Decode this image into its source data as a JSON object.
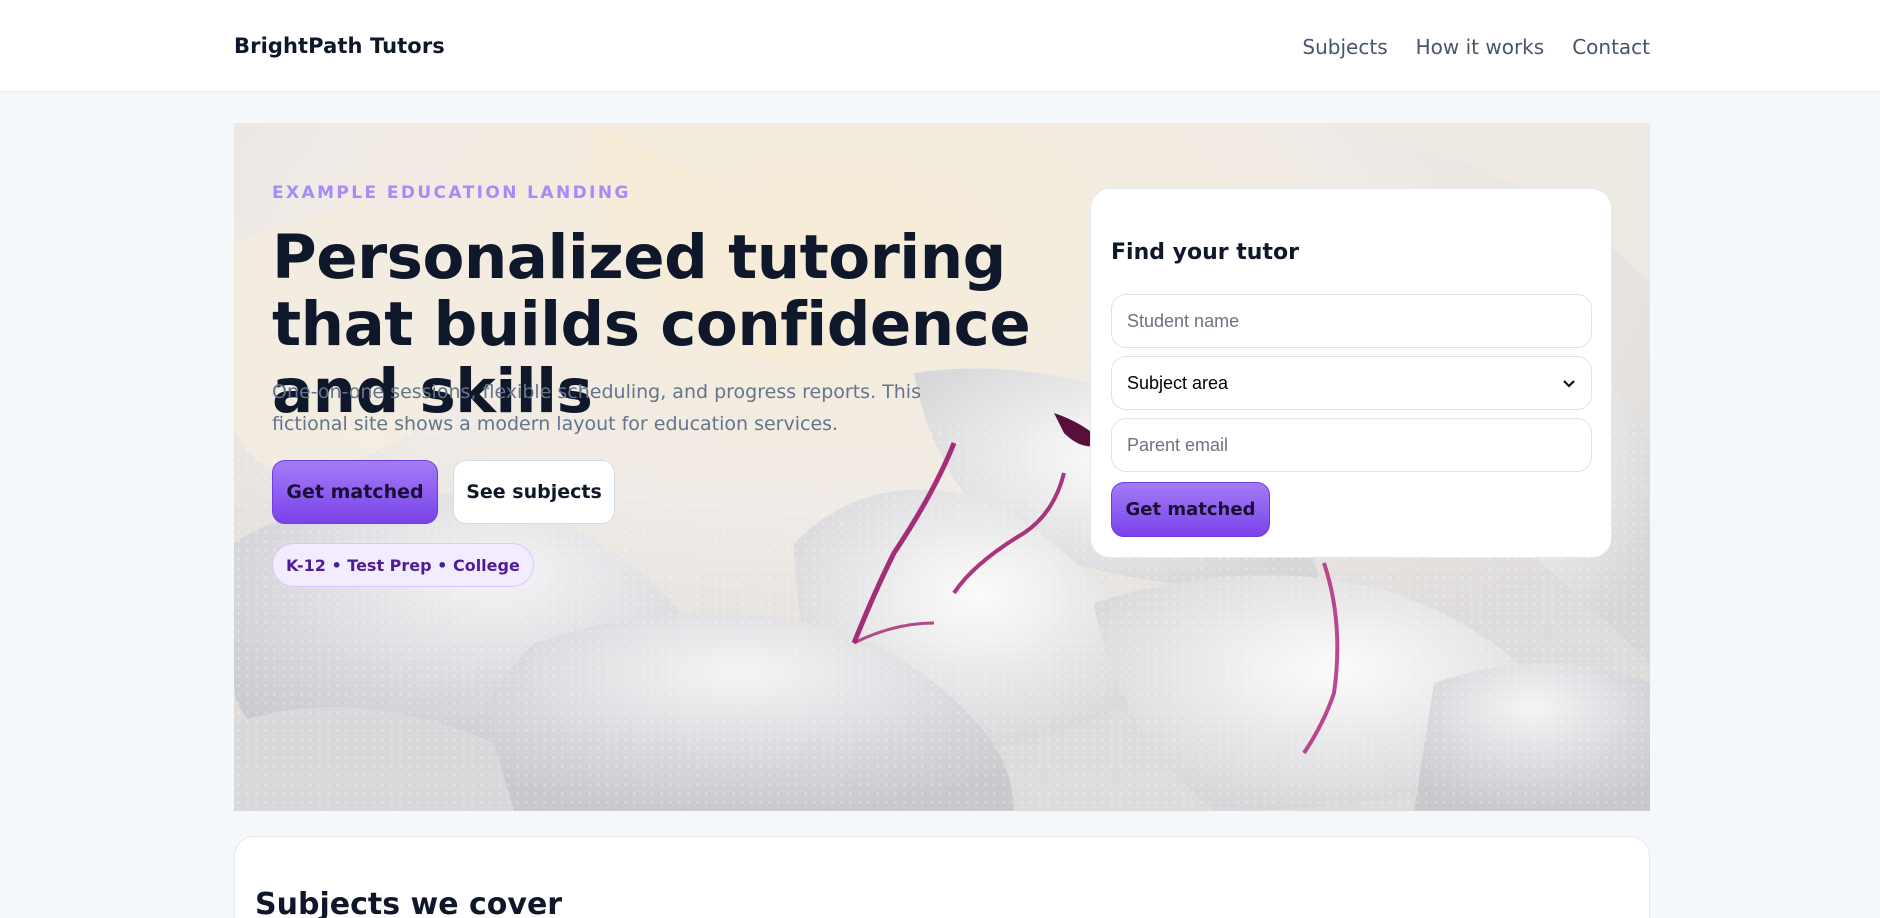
{
  "header": {
    "brand": "BrightPath Tutors",
    "nav": [
      "Subjects",
      "How it works",
      "Contact"
    ]
  },
  "hero": {
    "eyebrow": "EXAMPLE EDUCATION LANDING",
    "headline": "Personalized tutoring that builds confidence and skills",
    "subtext": "One-on-one sessions, flexible scheduling, and progress reports. This fictional site shows a modern layout for education services.",
    "primary_button": "Get matched",
    "secondary_button": "See subjects",
    "tags": "K-12 • Test Prep • College",
    "background_image": "white peony petals with water droplets"
  },
  "form": {
    "title": "Find your tutor",
    "student_placeholder": "Student name",
    "subject_selected": "Subject area",
    "email_placeholder": "Parent email",
    "submit": "Get matched"
  },
  "subjects": {
    "title": "Subjects we cover"
  },
  "colors": {
    "accent": "#8b5cf6",
    "accent_light": "#a78bfa",
    "text": "#0f172a",
    "muted": "#64748b",
    "page_bg": "#f5f8fb"
  }
}
